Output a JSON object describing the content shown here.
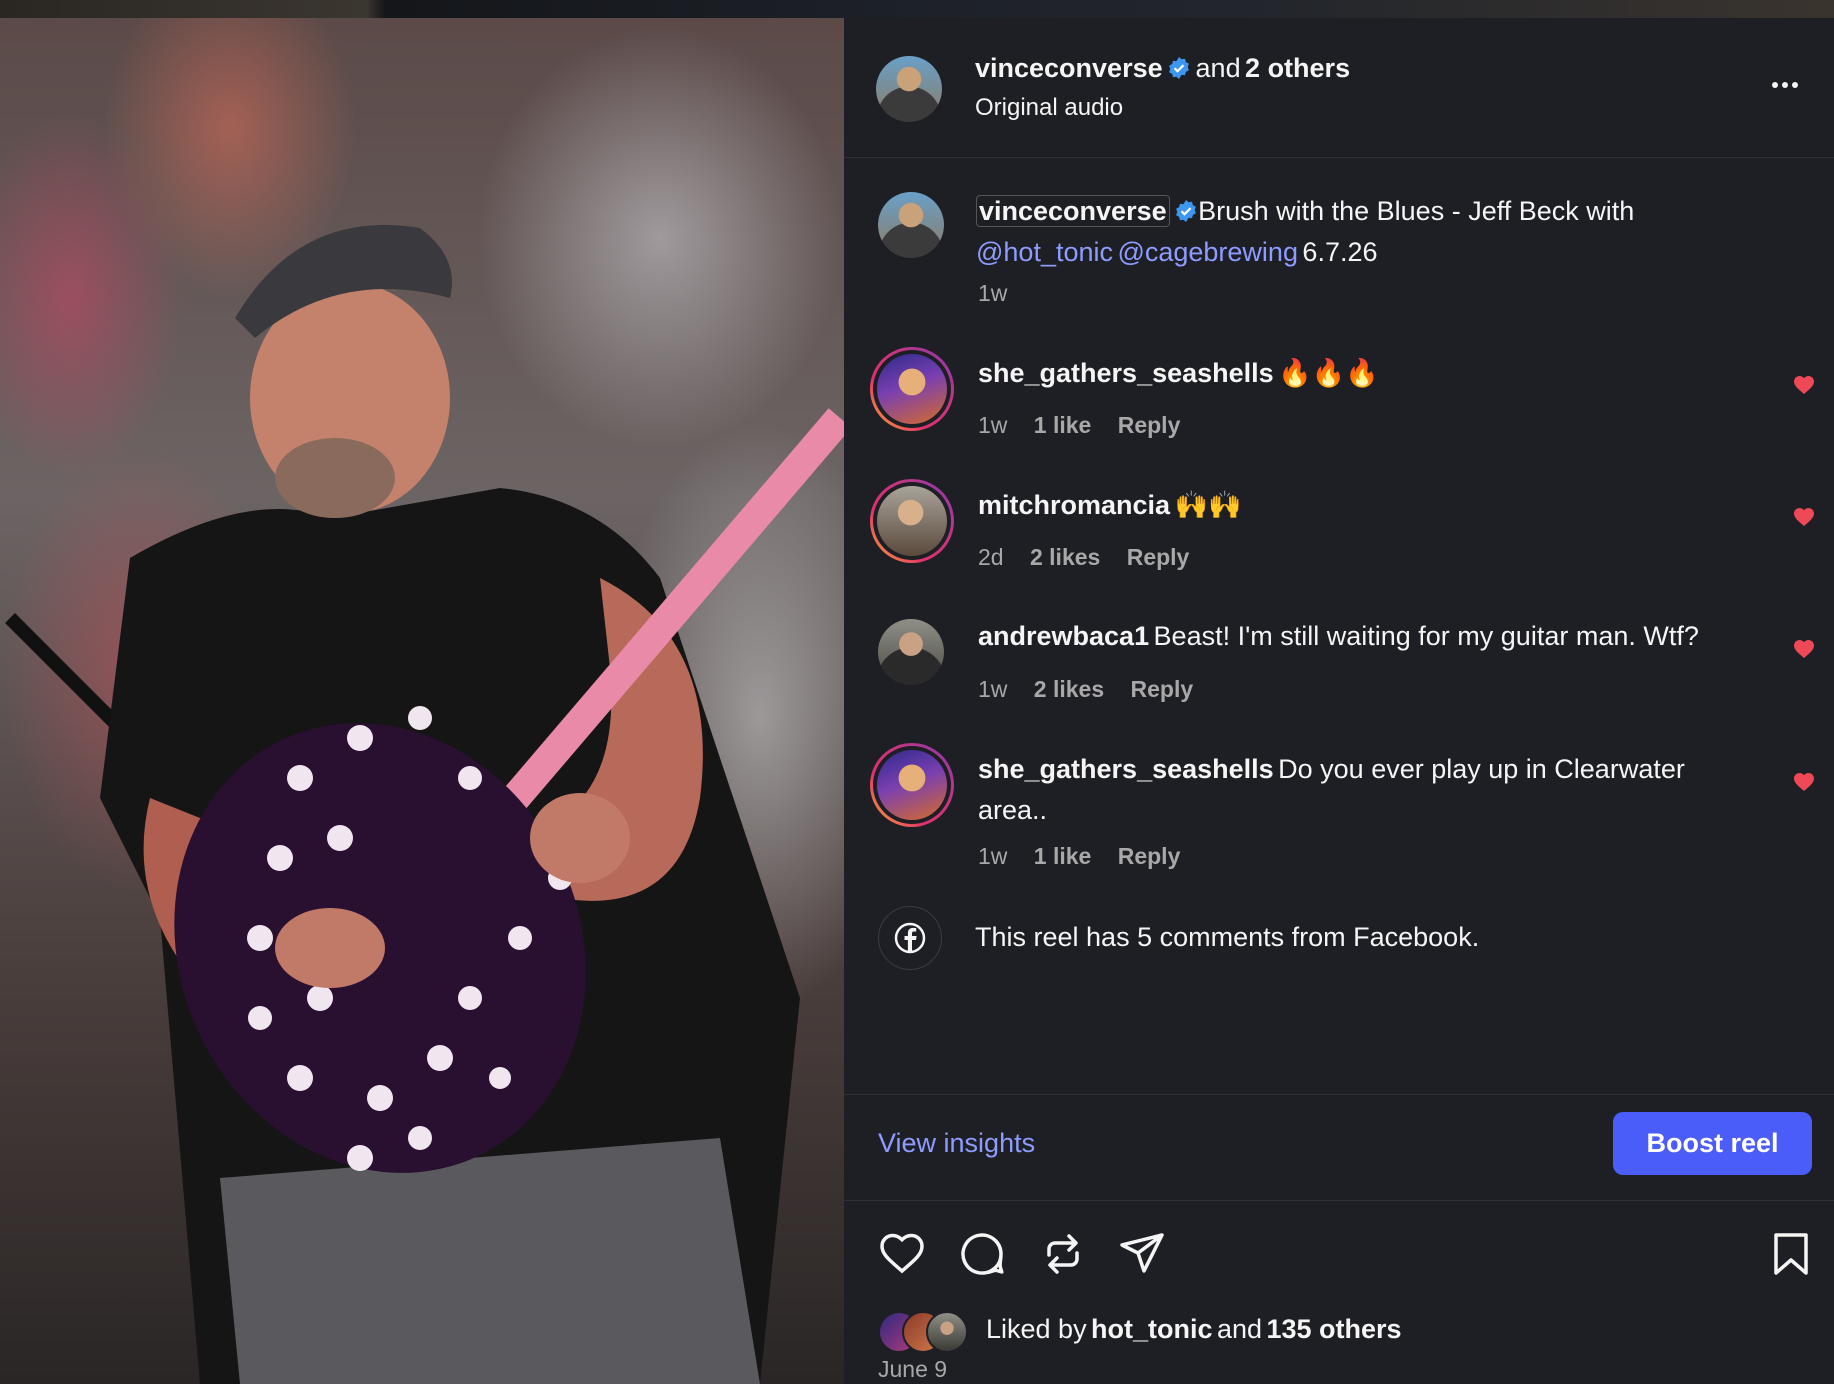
{
  "header": {
    "username": "vinceconverse",
    "and_text": "and",
    "others": "2 others",
    "audio": "Original audio"
  },
  "caption": {
    "username": "vinceconverse",
    "text": "Brush with the Blues - Jeff Beck with",
    "mention1": "@hot_tonic",
    "mention2": "@cagebrewing",
    "date_text": "6.7.26",
    "time": "1w"
  },
  "comments": [
    {
      "username": "she_gathers_seashells",
      "text": "🔥🔥🔥",
      "time": "1w",
      "likes": "1 like",
      "reply": "Reply"
    },
    {
      "username": "mitchromancia",
      "text": "🙌🙌",
      "time": "2d",
      "likes": "2 likes",
      "reply": "Reply"
    },
    {
      "username": "andrewbaca1",
      "text": "Beast! I'm still waiting for my guitar man. Wtf?",
      "time": "1w",
      "likes": "2 likes",
      "reply": "Reply"
    },
    {
      "username": "she_gathers_seashells",
      "text": "Do you ever play up in Clearwater",
      "text2": "area..",
      "time": "1w",
      "likes": "1 like",
      "reply": "Reply"
    }
  ],
  "facebook_note": "This reel has 5 comments from Facebook.",
  "actions": {
    "view_insights": "View insights",
    "boost": "Boost reel"
  },
  "likes": {
    "prefix": "Liked by",
    "user": "hot_tonic",
    "and_text": "and",
    "others": "135 others"
  },
  "post_date": "June 9",
  "colors": {
    "accent_link": "#8e9cff",
    "boost_button": "#4a5df9",
    "heart_red": "#ed4956",
    "verified_blue": "#3d97f0",
    "panel_bg": "#1e1f24"
  },
  "icons": [
    "more-icon",
    "verified-icon",
    "heart-icon",
    "comment-icon",
    "repost-icon",
    "share-icon",
    "bookmark-icon",
    "facebook-icon"
  ]
}
